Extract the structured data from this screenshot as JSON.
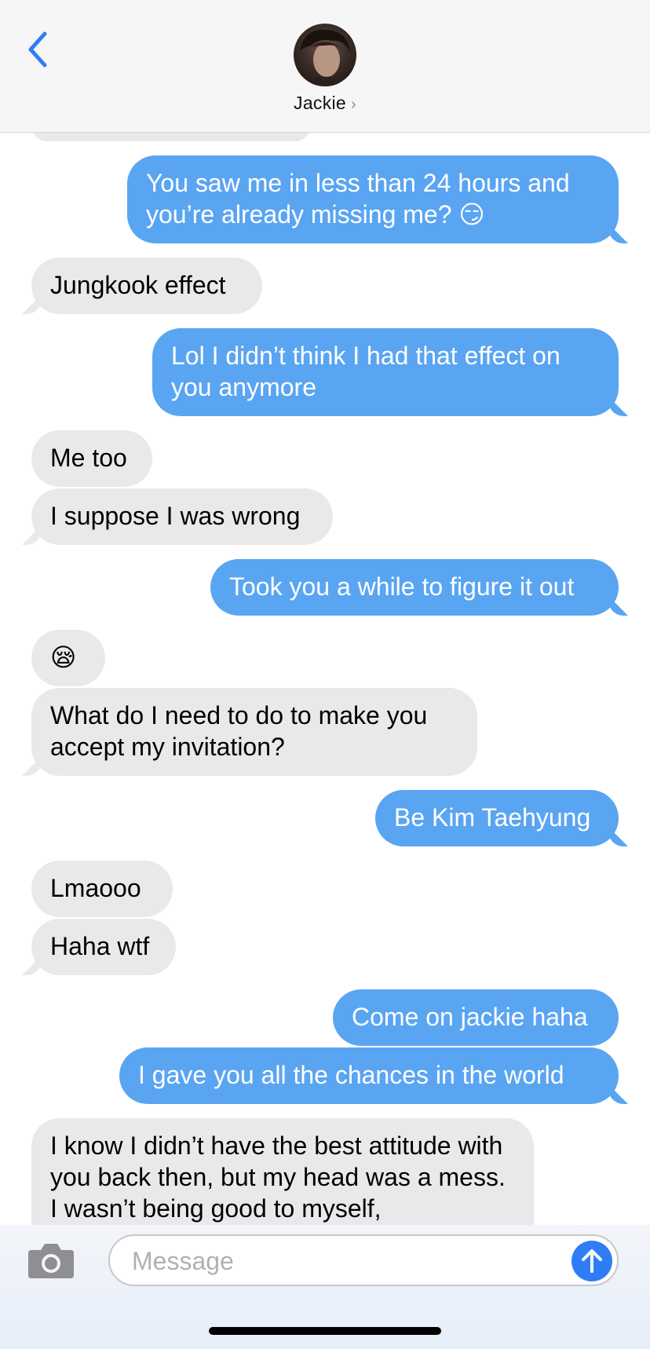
{
  "header": {
    "contact_name": "Jackie",
    "chevron": "›"
  },
  "messages": [
    {
      "text": ""
    },
    {
      "text": "You saw me in less than 24 hours and you’re already missing me? 😏"
    },
    {
      "text": "Jungkook effect"
    },
    {
      "text": "Lol I didn’t think I had that effect on you anymore"
    },
    {
      "text": "Me too"
    },
    {
      "text": "I suppose I was wrong"
    },
    {
      "text": "Took you a while to figure it out"
    },
    {
      "text": "😪"
    },
    {
      "text": "What do I need to do to make you accept my invitation?"
    },
    {
      "text": "Be Kim Taehyung"
    },
    {
      "text": "Lmaooo"
    },
    {
      "text": "Haha wtf"
    },
    {
      "text": "Come on jackie haha"
    },
    {
      "text": "I gave you all the chances in the world"
    },
    {
      "text": "I know I didn’t have the best attitude with you back then, but my head was a mess. I wasn’t being good to myself,"
    }
  ],
  "composer": {
    "placeholder": "Message"
  },
  "colors": {
    "outgoing": "#5aa5f2",
    "incoming": "#e9e9eb",
    "accent": "#2f7df5"
  },
  "icons": [
    "back-chevron-icon",
    "camera-icon",
    "send-arrow-icon"
  ]
}
